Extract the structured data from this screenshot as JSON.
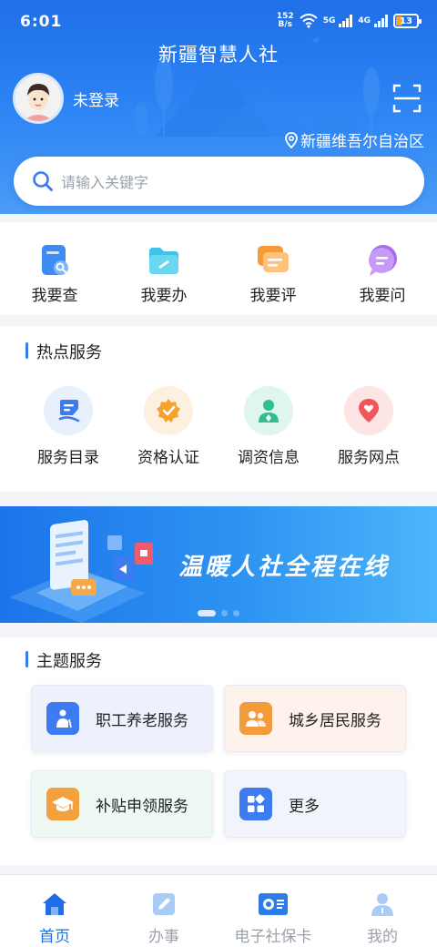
{
  "status_bar": {
    "time": "6:01",
    "speed_value": "152",
    "speed_unit": "B/s",
    "net1": "5G",
    "net2": "4G",
    "battery": "13"
  },
  "header": {
    "app_title": "新疆智慧人社",
    "login_text": "未登录",
    "location": "新疆维吾尔自治区"
  },
  "search": {
    "placeholder": "请输入关键字"
  },
  "quick_actions": [
    {
      "label": "我要查",
      "icon": "query-doc-icon",
      "color": "#3d8cf5"
    },
    {
      "label": "我要办",
      "icon": "folder-edit-icon",
      "color": "#3dc4e8"
    },
    {
      "label": "我要评",
      "icon": "comment-icon",
      "color": "#f59a3a"
    },
    {
      "label": "我要问",
      "icon": "chat-bubble-icon",
      "color": "#a76cf0"
    }
  ],
  "hot_services": {
    "title": "热点服务",
    "items": [
      {
        "label": "服务目录",
        "icon": "catalog-icon",
        "color": "#3d7cf0",
        "bg": "#e8effd"
      },
      {
        "label": "资格认证",
        "icon": "certify-badge-icon",
        "color": "#f5a22f",
        "bg": "#fdf0df"
      },
      {
        "label": "调资信息",
        "icon": "person-info-icon",
        "color": "#2fbf8f",
        "bg": "#dff6ee"
      },
      {
        "label": "服务网点",
        "icon": "location-heart-icon",
        "color": "#f0575a",
        "bg": "#fde5e5"
      }
    ]
  },
  "banner": {
    "text": "温暖人社全程在线"
  },
  "theme_services": {
    "title": "主题服务",
    "items": [
      {
        "label": "职工养老服务",
        "icon": "elderly-worker-icon",
        "color": "#3d7cf0",
        "bg": "#eef1fb"
      },
      {
        "label": "城乡居民服务",
        "icon": "residents-icon",
        "color": "#f39c3c",
        "bg": "#fdf3ec"
      },
      {
        "label": "补贴申领服务",
        "icon": "graduation-cap-icon",
        "color": "#f3a03d",
        "bg": "#eef9f4"
      },
      {
        "label": "更多",
        "icon": "more-grid-icon",
        "color": "#3d7cf0",
        "bg": "#f1f4fb"
      }
    ]
  },
  "tabbar": {
    "items": [
      {
        "label": "首页",
        "icon": "home-icon",
        "active": true
      },
      {
        "label": "办事",
        "icon": "edit-icon",
        "active": false
      },
      {
        "label": "电子社保卡",
        "icon": "social-card-icon",
        "active": false
      },
      {
        "label": "我的",
        "icon": "profile-icon",
        "active": false
      }
    ]
  },
  "colors": {
    "primary": "#1f6fe8",
    "accent_bar": "#3a7cf0",
    "tab_inactive": "#9aa1ab"
  }
}
